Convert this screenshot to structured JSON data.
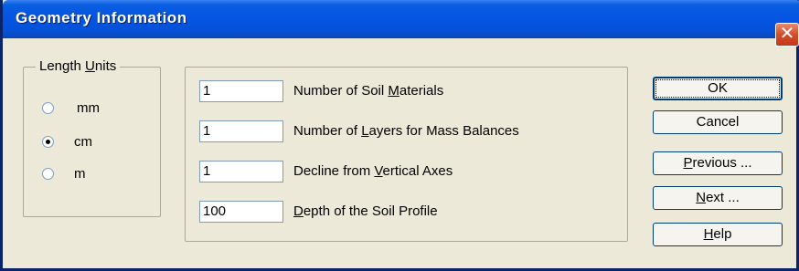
{
  "window": {
    "title": "Geometry Information",
    "close_glyph": "✕"
  },
  "length_units": {
    "legend_prefix": "Length ",
    "legend_access": "U",
    "legend_suffix": "nits",
    "options": [
      {
        "label": "mm",
        "checked": false
      },
      {
        "label": "cm",
        "checked": true
      },
      {
        "label": "m",
        "checked": false
      }
    ]
  },
  "fields": [
    {
      "value": "1",
      "label_pre": "Number of Soil ",
      "label_access": "M",
      "label_post": "aterials"
    },
    {
      "value": "1",
      "label_pre": "Number of ",
      "label_access": "L",
      "label_post": "ayers for Mass Balances"
    },
    {
      "value": "1",
      "label_pre": "Decline from ",
      "label_access": "V",
      "label_post": "ertical Axes"
    },
    {
      "value": "100",
      "label_pre": "",
      "label_access": "D",
      "label_post": "epth of the Soil Profile"
    }
  ],
  "buttons": {
    "ok": "OK",
    "cancel": "Cancel",
    "previous_access": "P",
    "previous_rest": "revious ...",
    "next_access": "N",
    "next_rest": "ext ...",
    "help_access": "H",
    "help_rest": "elp"
  }
}
